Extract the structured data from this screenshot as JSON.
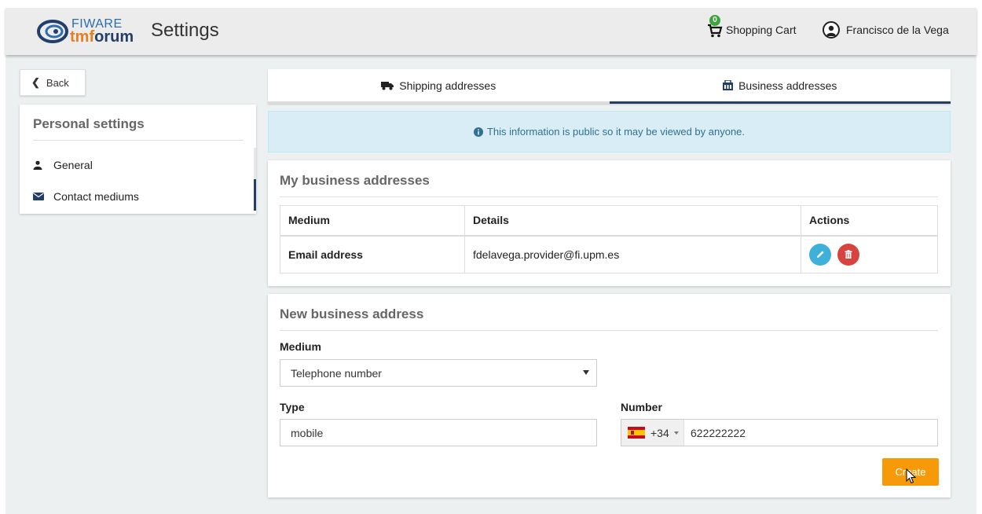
{
  "header": {
    "logo_top": "FIWARE",
    "logo_bottom_a": "tmf",
    "logo_bottom_b": "orum",
    "title": "Settings",
    "cart_count": "0",
    "cart_label": "Shopping Cart",
    "user_name": "Francisco de la Vega"
  },
  "sidebar": {
    "back_label": "Back",
    "title": "Personal settings",
    "items": [
      {
        "label": "General",
        "icon": "user-icon"
      },
      {
        "label": "Contact mediums",
        "icon": "envelope-icon",
        "active": true
      }
    ]
  },
  "tabs": [
    {
      "label": "Shipping addresses",
      "icon": "truck-icon"
    },
    {
      "label": "Business addresses",
      "icon": "building-icon",
      "active": true
    }
  ],
  "info_message": "This information is public so it may be viewed by anyone.",
  "my_addresses": {
    "title": "My business addresses",
    "columns": [
      "Medium",
      "Details",
      "Actions"
    ],
    "rows": [
      {
        "medium": "Email address",
        "details": "fdelavega.provider@fi.upm.es"
      }
    ]
  },
  "new_address": {
    "title": "New business address",
    "medium_label": "Medium",
    "medium_value": "Telephone number",
    "type_label": "Type",
    "type_value": "mobile",
    "number_label": "Number",
    "dial_code": "+34",
    "number_value": "622222222",
    "create_label": "Create"
  },
  "colors": {
    "brand_navy": "#233e6b",
    "accent_orange": "#f79a0a",
    "info_bg": "#d9edf7",
    "edit_blue": "#3fb0d9",
    "delete_red": "#d9433f",
    "cart_badge_green": "#3ca63c"
  }
}
